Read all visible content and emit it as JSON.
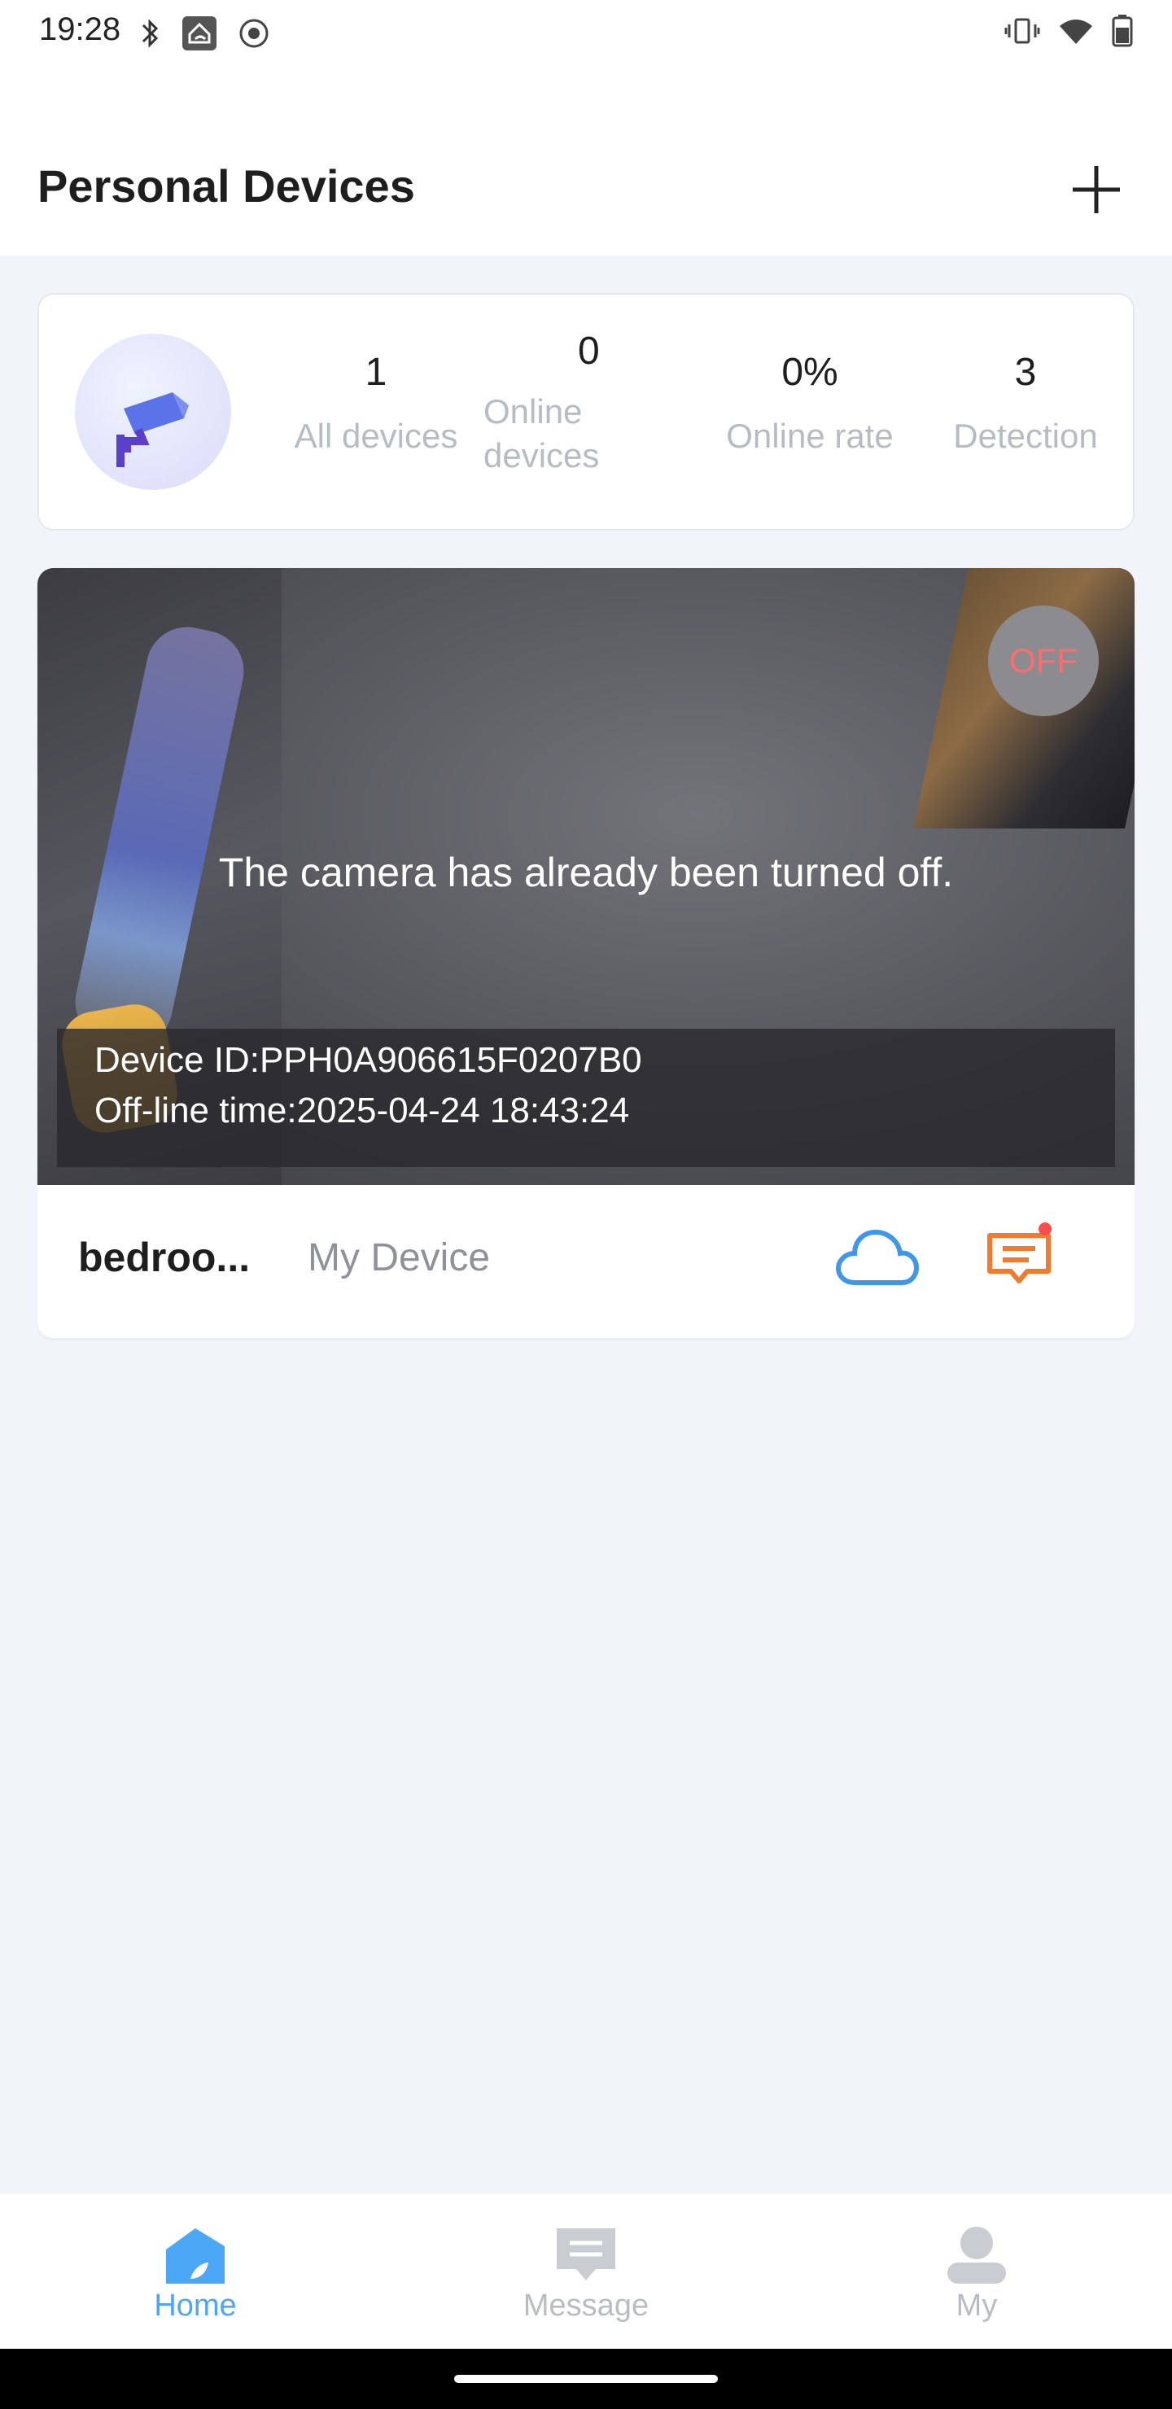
{
  "status_bar": {
    "time": "19:28",
    "left_icons": [
      "bluetooth-icon",
      "home-app-icon",
      "record-icon"
    ],
    "right_icons": [
      "vibrate-icon",
      "wifi-icon",
      "battery-icon"
    ]
  },
  "header": {
    "title": "Personal Devices",
    "add_icon": "plus-icon"
  },
  "summary": {
    "stats": [
      {
        "value": "1",
        "label": "All devices"
      },
      {
        "value": "0",
        "label": "Online devices"
      },
      {
        "value": "0%",
        "label": "Online rate"
      },
      {
        "value": "3",
        "label": "Detection"
      }
    ],
    "avatar_icon": "camera-icon"
  },
  "device_card": {
    "power_state": "OFF",
    "message": "The camera has already been turned off.",
    "device_id": "Device ID:PPH0A906615F0207B0",
    "offline_time": "Off-line time:2025-04-24 18:43:24",
    "name": "bedroo...",
    "group": "My Device",
    "actions": [
      "cloud-icon",
      "message-icon"
    ],
    "colors": {
      "cloud": "#3f97ea",
      "message": "#f07a2e",
      "notification_dot": "#ff4d4d"
    }
  },
  "bottom_nav": {
    "items": [
      {
        "label": "Home",
        "icon": "home-icon",
        "active": true
      },
      {
        "label": "Message",
        "icon": "message-icon",
        "active": false
      },
      {
        "label": "My",
        "icon": "user-icon",
        "active": false
      }
    ],
    "colors": {
      "active": "#4aa8f7",
      "inactive": "#b9bdc3"
    }
  }
}
